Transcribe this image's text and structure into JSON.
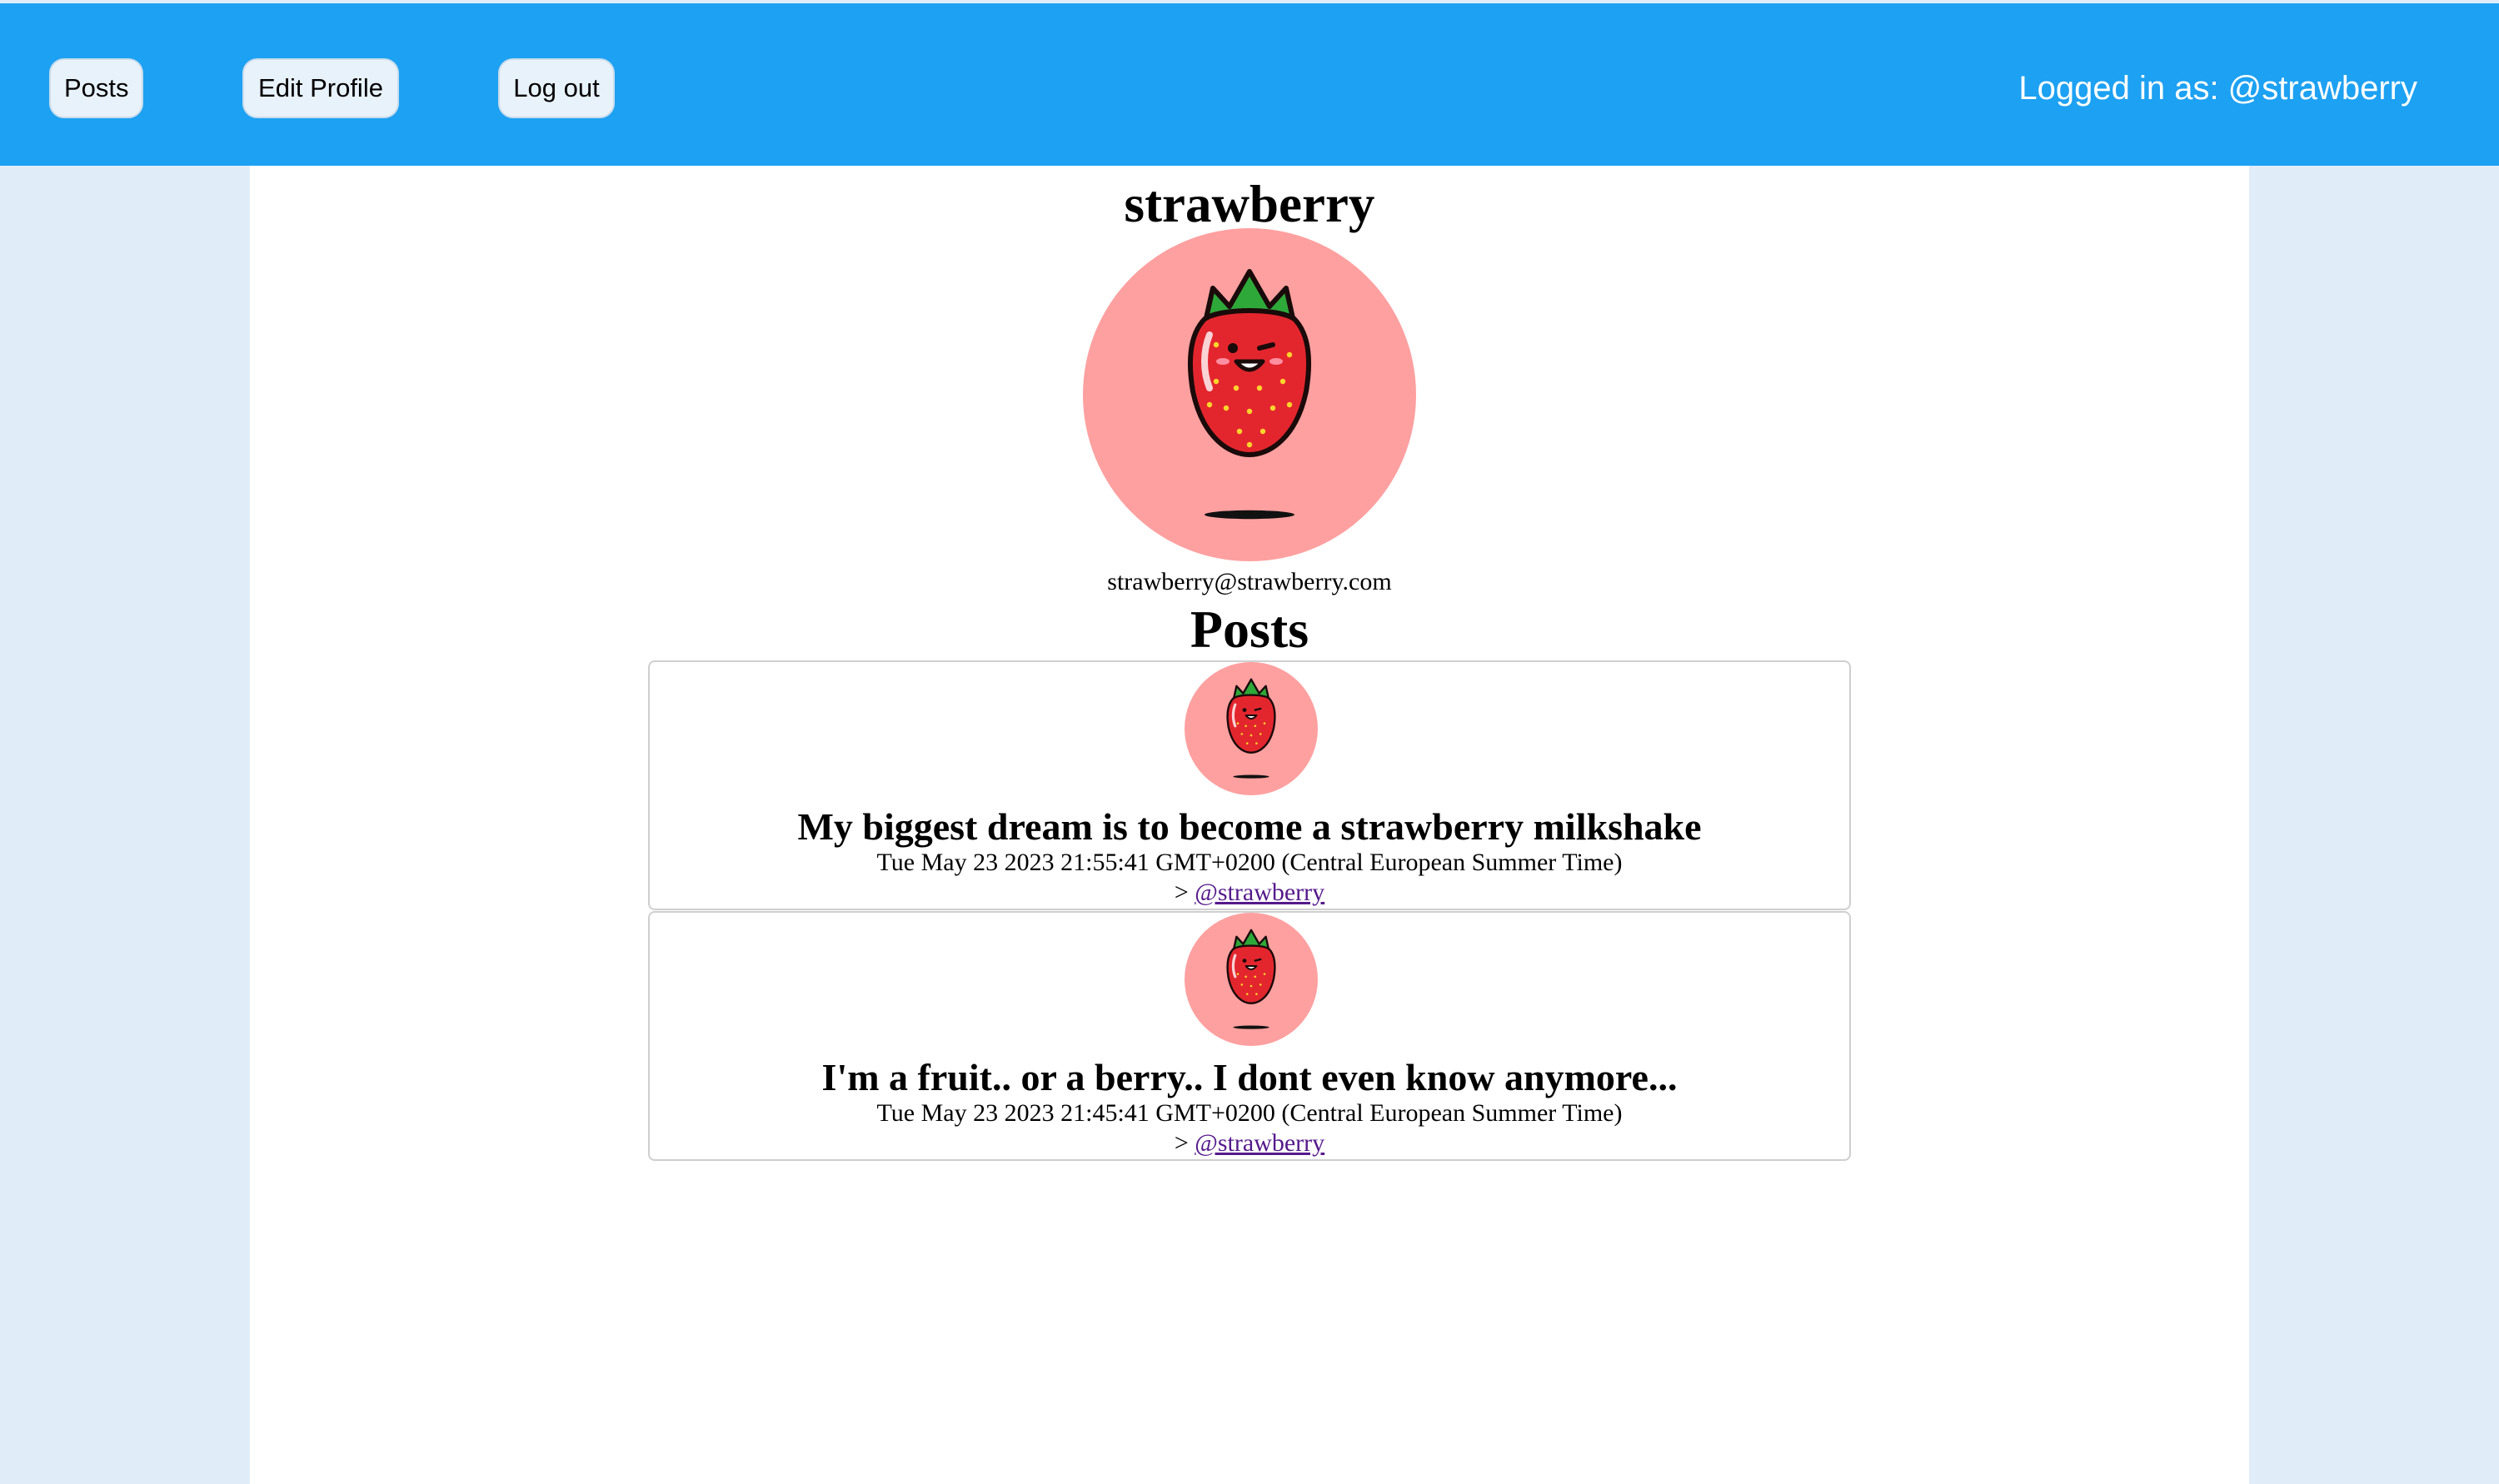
{
  "nav": {
    "posts_label": "Posts",
    "edit_profile_label": "Edit Profile",
    "logout_label": "Log out",
    "logged_in_text": "Logged in as: @strawberry"
  },
  "profile": {
    "name": "strawberry",
    "email": "strawberry@strawberry.com",
    "avatar_icon": "strawberry-mascot-icon"
  },
  "posts_heading": "Posts",
  "posts": [
    {
      "title": "My biggest dream is to become a strawberry milkshake",
      "date": "Tue May 23 2023 21:55:41 GMT+0200 (Central European Summer Time)",
      "author_prefix": ">",
      "author": "@strawberry"
    },
    {
      "title": "I'm a fruit.. or a berry.. I dont even know anymore...",
      "date": "Tue May 23 2023 21:45:41 GMT+0200 (Central European Summer Time)",
      "author_prefix": ">",
      "author": "@strawberry"
    }
  ],
  "colors": {
    "topbar": "#1da1f2",
    "page_bg": "#e0edf9",
    "avatar_bg": "#ffa0a0",
    "strawberry_red": "#e3262e",
    "leaf_green": "#2fa83a",
    "link_visited": "#551a8b"
  }
}
